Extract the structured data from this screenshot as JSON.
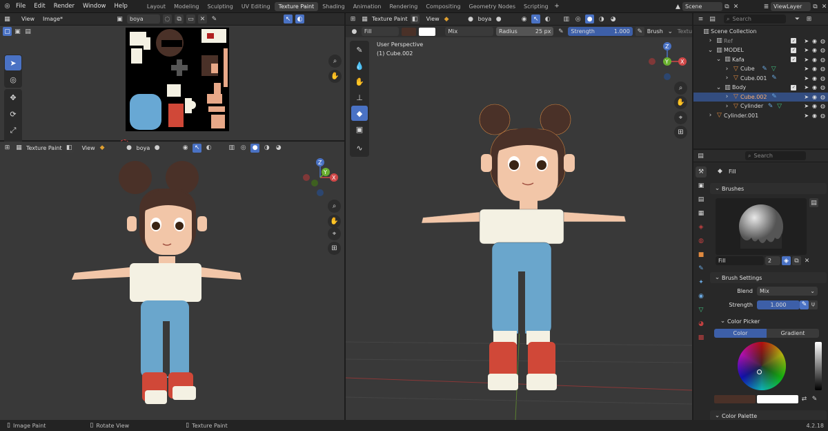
{
  "top_menu": {
    "items": [
      "File",
      "Edit",
      "Render",
      "Window",
      "Help"
    ]
  },
  "workspaces": [
    "Layout",
    "Modeling",
    "Sculpting",
    "UV Editing",
    "Texture Paint",
    "Shading",
    "Animation",
    "Rendering",
    "Compositing",
    "Geometry Nodes",
    "Scripting"
  ],
  "active_workspace": "Texture Paint",
  "scene": {
    "scene_name": "Scene",
    "view_layer": "ViewLayer"
  },
  "image_editor": {
    "view": "View",
    "image": "Image*",
    "image_name": "boya"
  },
  "viewport_small": {
    "mode": "Texture Paint",
    "view": "View",
    "material": "boya"
  },
  "viewport_main": {
    "mode": "Texture Paint",
    "view": "View",
    "material": "boya",
    "brush_name": "Fill",
    "blend": "Mix",
    "radius_label": "Radius",
    "radius_value": "25 px",
    "strength_label": "Strength",
    "strength_value": "1.000",
    "brush_menu": "Brush",
    "texture_menu": "Textu",
    "perspective": "User Perspective",
    "object": "(1) Cube.002"
  },
  "outliner": {
    "search_placeholder": "Search",
    "collection": "Scene Collection",
    "rows": [
      {
        "label": "Ref",
        "level": 1
      },
      {
        "label": "MODEL",
        "level": 1
      },
      {
        "label": "Kafa",
        "level": 2
      },
      {
        "label": "Cube",
        "level": 3
      },
      {
        "label": "Cube.001",
        "level": 3
      },
      {
        "label": "Body",
        "level": 2
      },
      {
        "label": "Cube.002",
        "level": 3,
        "selected": true
      },
      {
        "label": "Cylinder",
        "level": 3
      },
      {
        "label": "Cylinder.001",
        "level": 1
      }
    ]
  },
  "properties": {
    "search_placeholder": "Search",
    "tool_name": "Fill",
    "brushes_label": "Brushes",
    "brush_field": "Fill",
    "brush_users": "2",
    "brush_settings_label": "Brush Settings",
    "blend_label": "Blend",
    "blend_value": "Mix",
    "strength_label": "Strength",
    "strength_value": "1.000",
    "color_picker_label": "Color Picker",
    "color_tab": "Color",
    "gradient_tab": "Gradient",
    "color_palette_label": "Color Palette"
  },
  "status_bar": {
    "left1": "Image Paint",
    "left2": "Rotate View",
    "left3": "Texture Paint",
    "version": "4.2.18"
  },
  "colors": {
    "accent": "#4a72c4",
    "selected_row": "#334d80",
    "brush_color": "#4a3128",
    "secondary_color": "#ffffff"
  }
}
